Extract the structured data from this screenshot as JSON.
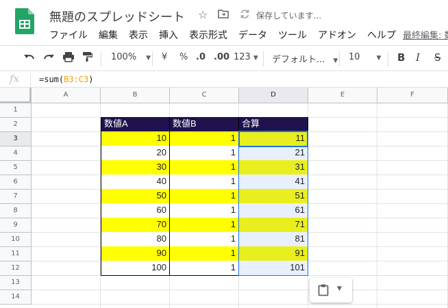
{
  "app": {
    "title": "無題のスプレッドシート",
    "saving_status": "保存しています...",
    "last_edit_link": "最終編集: 数"
  },
  "menu": [
    "ファイル",
    "編集",
    "表示",
    "挿入",
    "表示形式",
    "データ",
    "ツール",
    "アドオン",
    "ヘルプ"
  ],
  "toolbar": {
    "zoom": "100%",
    "currency": "¥",
    "percent": "%",
    "decimal_decrease": ".0",
    "decimal_increase": ".00",
    "number_format": "123",
    "font": "デフォルト...",
    "font_size": "10",
    "bold": "B",
    "italic": "I",
    "strike": "S"
  },
  "formula_bar": {
    "fx_label": "fx",
    "formula_prefix": "=sum(",
    "formula_range": "B3:C3",
    "formula_suffix": ")"
  },
  "sheet": {
    "columns": [
      "A",
      "B",
      "C",
      "D",
      "E",
      "F"
    ],
    "rows": [
      "1",
      "2",
      "3",
      "4",
      "5",
      "6",
      "7",
      "8",
      "9",
      "10",
      "11",
      "12",
      "13",
      "14"
    ],
    "header": {
      "b": "数値A",
      "c": "数値B",
      "d": "合算"
    },
    "data": [
      {
        "a": "10",
        "b": "1",
        "sum": "11"
      },
      {
        "a": "20",
        "b": "1",
        "sum": "21"
      },
      {
        "a": "30",
        "b": "1",
        "sum": "31"
      },
      {
        "a": "40",
        "b": "1",
        "sum": "41"
      },
      {
        "a": "50",
        "b": "1",
        "sum": "51"
      },
      {
        "a": "60",
        "b": "1",
        "sum": "61"
      },
      {
        "a": "70",
        "b": "1",
        "sum": "71"
      },
      {
        "a": "80",
        "b": "1",
        "sum": "81"
      },
      {
        "a": "90",
        "b": "1",
        "sum": "91"
      },
      {
        "a": "100",
        "b": "1",
        "sum": "101"
      }
    ],
    "colors": {
      "header_bg": "#20124d",
      "highlight_yellow": "#ffff00",
      "sum_highlight": "#e9ef1f",
      "selection_blue": "#1a73e8",
      "formula_range": "#f4a000"
    }
  },
  "icons": {
    "logo": "sheets-logo",
    "star": "star-icon",
    "move": "move-to-folder-icon",
    "saving": "sync-icon",
    "paste": "clipboard-icon"
  }
}
